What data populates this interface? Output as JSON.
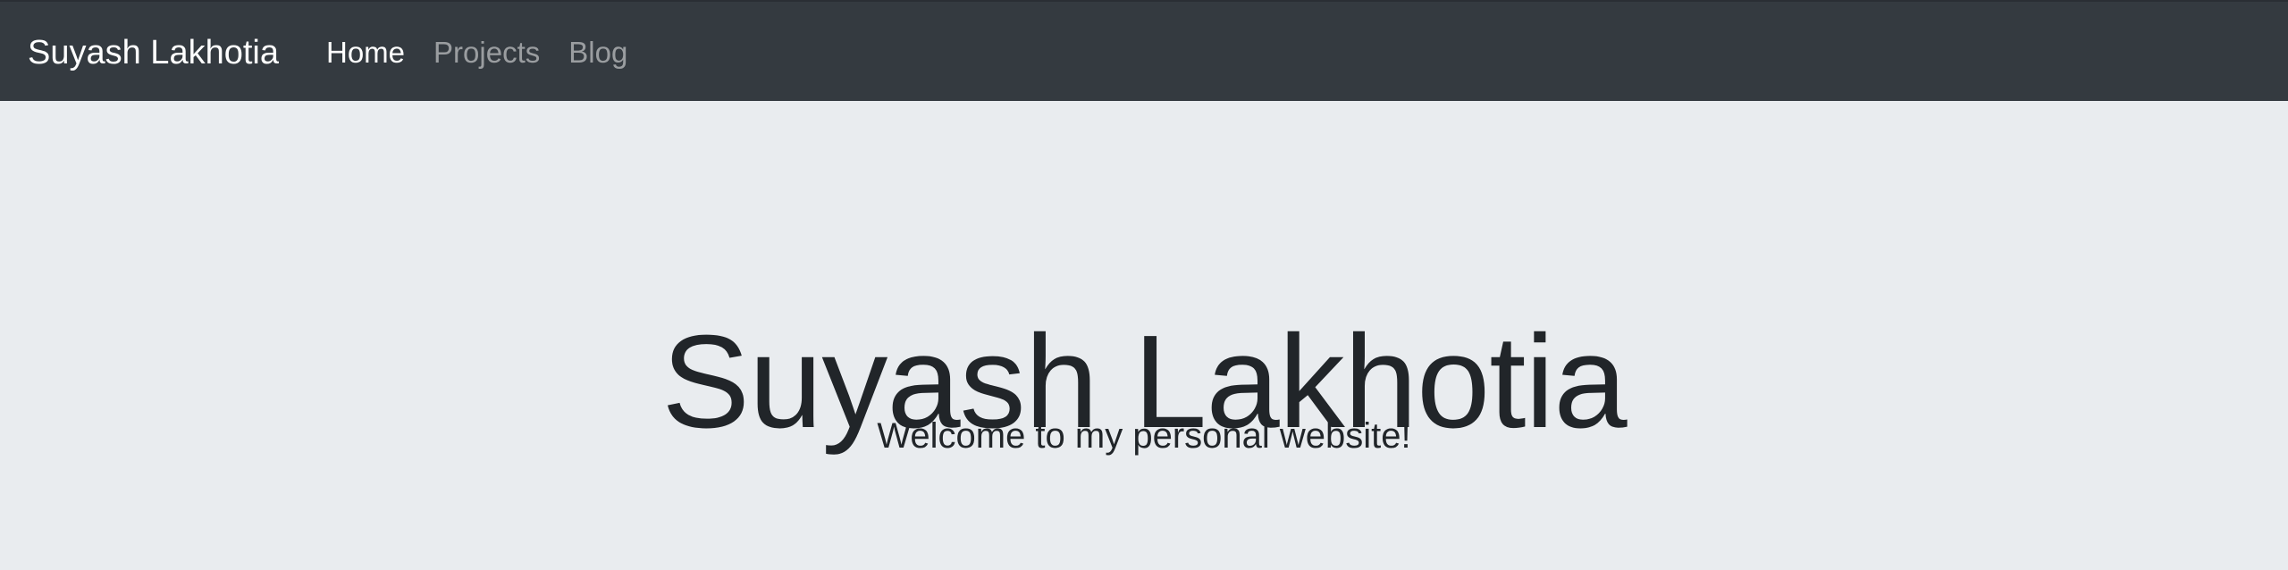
{
  "navbar": {
    "brand": "Suyash Lakhotia",
    "links": [
      {
        "label": "Home",
        "active": true
      },
      {
        "label": "Projects",
        "active": false
      },
      {
        "label": "Blog",
        "active": false
      }
    ]
  },
  "hero": {
    "title": "Suyash Lakhotia",
    "lead": "Welcome to my personal website!"
  },
  "colors": {
    "navbar_bg": "#343a40",
    "page_bg": "#e9ecef",
    "text": "#212529"
  }
}
